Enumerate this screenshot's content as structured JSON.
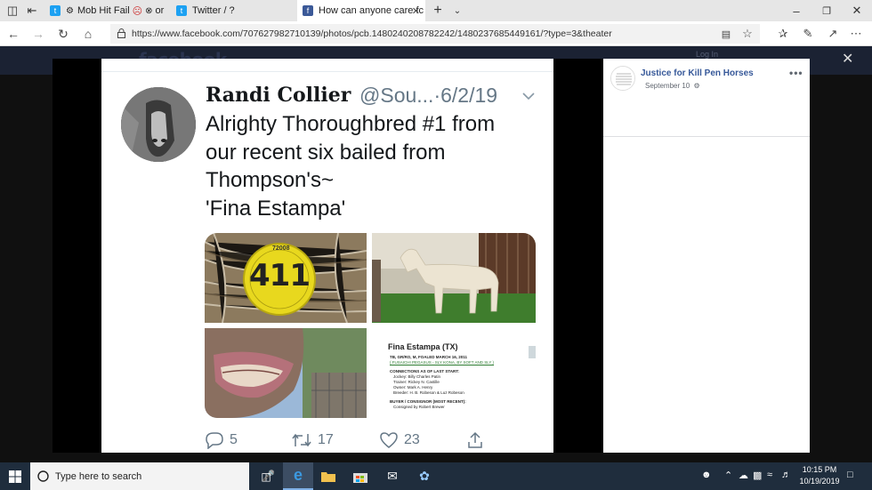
{
  "browser": {
    "tabs": [
      {
        "label": "Mob Hit Fail",
        "suffix": "or",
        "favicon": "twitter-icon",
        "color": "#1da1f2"
      },
      {
        "label": "Twitter / ?",
        "favicon": "twitter-icon",
        "color": "#1da1f2"
      },
      {
        "label": "How can anyone care fc",
        "favicon": "facebook-icon",
        "color": "#3b5998"
      }
    ],
    "url": "https://www.facebook.com/707627982710139/photos/pcb.1480240208782242/1480237685449161/?type=3&theater"
  },
  "facebook": {
    "logo": "facebook",
    "login": "Log In",
    "post_author": "Justice for Kill Pen Horses",
    "post_date": "September 10",
    "more": "•••"
  },
  "tweet": {
    "name": "Randi Collier",
    "handle": "@Sou...",
    "date": "·6/2/19",
    "text_lines": [
      "Alrighty Thoroughbred #1 from",
      "our recent six bailed from",
      "Thompson's~",
      "'Fina Estampa'"
    ],
    "tag_number": "411",
    "tag_text": "72008",
    "card": {
      "title": "Fina Estampa (TX)",
      "lines": [
        "TB, GR/RO, M, FOALED MARCH 16, 2011",
        "( FUSAICHI PEGASUS - SLY KONA, BY SOFT AND SLY )",
        "CONNECTIONS AS OF LAST START:",
        "Jockey: Billy Charles Patin",
        "Trainer: Rickey N. Castille",
        "Owner: Mark A. Henry",
        "Breeder: H. B. Robeson & Luz Robeson",
        "BUYER / CONSIGNOR (MOST RECENT):",
        "Consigned by Robert Brewer"
      ]
    },
    "replies": "5",
    "retweets": "17",
    "likes": "23"
  },
  "taskbar": {
    "search_placeholder": "Type here to search",
    "time": "10:15 PM",
    "date": "10/19/2019"
  }
}
